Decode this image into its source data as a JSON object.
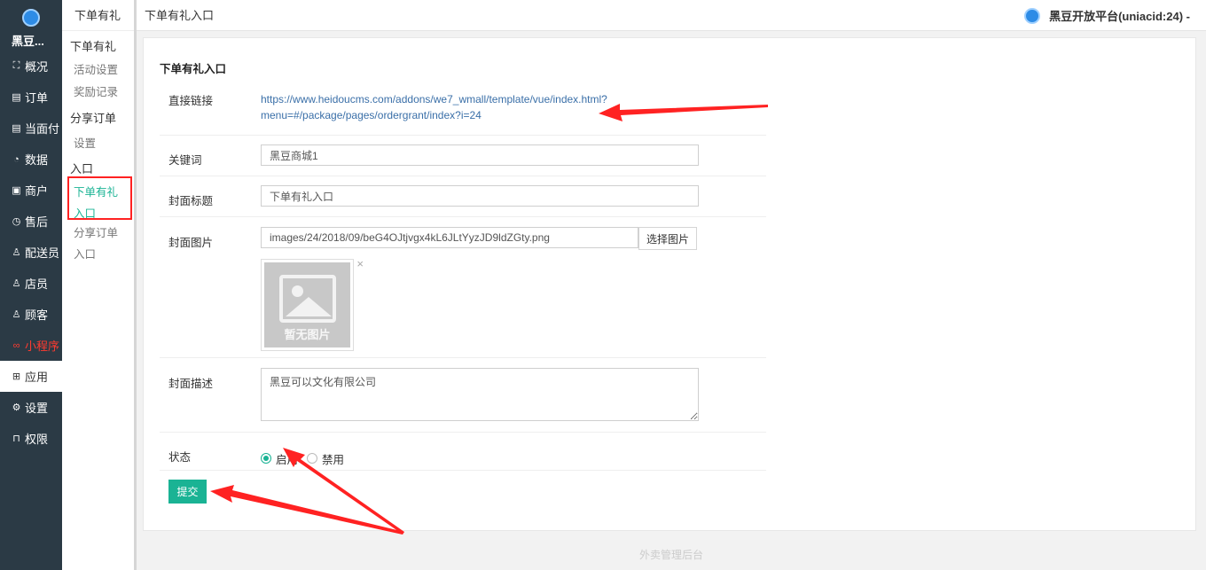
{
  "sidebar": {
    "brand": "黑豆...",
    "items": [
      {
        "label": "概况",
        "icon": "dashboard-icon",
        "glyph": "⛶"
      },
      {
        "label": "订单",
        "icon": "order-icon",
        "glyph": "▤"
      },
      {
        "label": "当面付",
        "icon": "pay-icon",
        "glyph": "▤"
      },
      {
        "label": "数据",
        "icon": "chart-icon",
        "glyph": "◔"
      },
      {
        "label": "商户",
        "icon": "store-icon",
        "glyph": "▣"
      },
      {
        "label": "售后",
        "icon": "service-icon",
        "glyph": "◷"
      },
      {
        "label": "配送员",
        "icon": "courier-icon",
        "glyph": "♙"
      },
      {
        "label": "店员",
        "icon": "clerk-icon",
        "glyph": "♙"
      },
      {
        "label": "顾客",
        "icon": "customer-icon",
        "glyph": "♙"
      },
      {
        "label": "小程序",
        "icon": "miniprogram-icon",
        "glyph": "∞"
      },
      {
        "label": "应用",
        "icon": "apps-icon",
        "glyph": "⊞"
      },
      {
        "label": "设置",
        "icon": "gear-icon",
        "glyph": "⚙"
      },
      {
        "label": "权限",
        "icon": "lock-icon",
        "glyph": "⊓"
      }
    ]
  },
  "subnav": {
    "title": "下单有礼",
    "group1": "下单有礼",
    "activity": "活动设置",
    "reward": "奖励记录",
    "group2": "分享订单",
    "settings": "设置",
    "group3": "入口",
    "entry1a": "下单有礼",
    "entry1b": "入口",
    "entry2a": "分享订单",
    "entry2b": "入口"
  },
  "topbar": {
    "breadcrumb": "下单有礼入口",
    "account": "黑豆开放平台(uniacid:24) -"
  },
  "form": {
    "title": "下单有礼入口",
    "link_label": "直接链接",
    "link_line1": "https://www.heidoucms.com/addons/we7_wmall/template/vue/index.html?",
    "link_line2": "menu=#/package/pages/ordergrant/index?i=24",
    "keyword_label": "关键词",
    "keyword_value": "黑豆商城1",
    "cover_title_label": "封面标题",
    "cover_title_value": "下单有礼入口",
    "cover_image_label": "封面图片",
    "cover_image_value": "images/24/2018/09/beG4OJtjvgx4kL6JLtYyzJD9ldZGty.png",
    "select_image": "选择图片",
    "no_image": "暂无图片",
    "close_glyph": "×",
    "cover_desc_label": "封面描述",
    "cover_desc_value": "黑豆可以文化有限公司",
    "status_label": "状态",
    "status_enable": "启用",
    "status_disable": "禁用",
    "submit": "提交"
  },
  "footer": "外卖管理后台",
  "colors": {
    "accent": "#1ab394",
    "sidebar_bg": "#2b3a45",
    "annotation": "#ff2222"
  }
}
